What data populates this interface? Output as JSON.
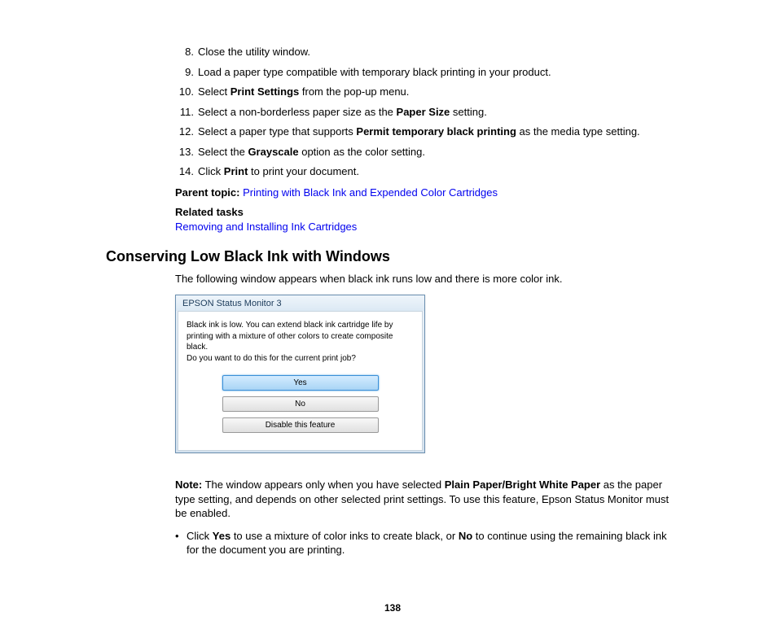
{
  "steps": [
    {
      "num": "8.",
      "parts": [
        {
          "t": "Close the utility window."
        }
      ]
    },
    {
      "num": "9.",
      "parts": [
        {
          "t": "Load a paper type compatible with temporary black printing in your product."
        }
      ]
    },
    {
      "num": "10.",
      "parts": [
        {
          "t": "Select "
        },
        {
          "t": "Print Settings",
          "b": true
        },
        {
          "t": " from the pop-up menu."
        }
      ]
    },
    {
      "num": "11.",
      "parts": [
        {
          "t": "Select a non-borderless paper size as the "
        },
        {
          "t": "Paper Size",
          "b": true
        },
        {
          "t": " setting."
        }
      ]
    },
    {
      "num": "12.",
      "parts": [
        {
          "t": "Select a paper type that supports "
        },
        {
          "t": "Permit temporary black printing",
          "b": true
        },
        {
          "t": " as the media type setting."
        }
      ]
    },
    {
      "num": "13.",
      "parts": [
        {
          "t": "Select the "
        },
        {
          "t": "Grayscale",
          "b": true
        },
        {
          "t": " option as the color setting."
        }
      ]
    },
    {
      "num": "14.",
      "parts": [
        {
          "t": "Click "
        },
        {
          "t": "Print",
          "b": true
        },
        {
          "t": " to print your document."
        }
      ]
    }
  ],
  "parentTopic": {
    "label": "Parent topic:",
    "link": "Printing with Black Ink and Expended Color Cartridges"
  },
  "relatedTasks": {
    "label": "Related tasks",
    "link": "Removing and Installing Ink Cartridges"
  },
  "heading": "Conserving Low Black Ink with Windows",
  "intro": "The following window appears when black ink runs low and there is more color ink.",
  "dialog": {
    "title": "EPSON Status Monitor 3",
    "message": "Black ink is low. You can extend black ink cartridge life by printing with a mixture of other colors to create composite black.\nDo you want to do this for the current print job?",
    "buttons": {
      "yes": "Yes",
      "no": "No",
      "disable": "Disable this feature"
    }
  },
  "note": {
    "label": "Note:",
    "parts": [
      {
        "t": " The window appears only when you have selected "
      },
      {
        "t": "Plain Paper/Bright White Paper",
        "b": true
      },
      {
        "t": " as the paper type setting, and depends on other selected print settings. To use this feature, Epson Status Monitor must be enabled."
      }
    ]
  },
  "bullet": {
    "parts": [
      {
        "t": "Click "
      },
      {
        "t": "Yes",
        "b": true
      },
      {
        "t": " to use a mixture of color inks to create black, or "
      },
      {
        "t": "No",
        "b": true
      },
      {
        "t": " to continue using the remaining black ink for the document you are printing."
      }
    ]
  },
  "pageNum": "138"
}
